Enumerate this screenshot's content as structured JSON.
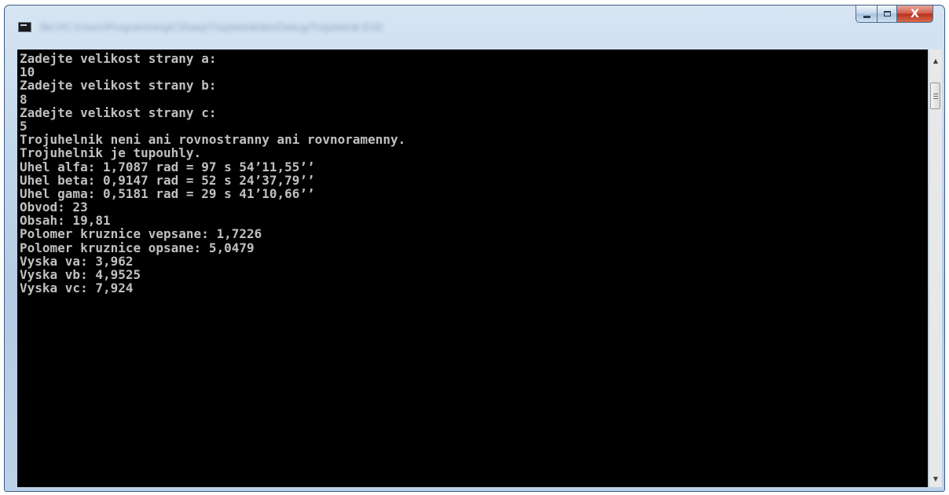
{
  "window": {
    "title": "file:///C:/Users/Programming/CSharp/Trojuhelnik/bin/Debug/Trojuhelnik.EXE"
  },
  "controls": {
    "minimize_icon": "minimize-icon",
    "maximize_icon": "maximize-icon",
    "close_label": "X"
  },
  "console": {
    "lines": [
      "Zadejte velikost strany a:",
      "10",
      "Zadejte velikost strany b:",
      "8",
      "Zadejte velikost strany c:",
      "5",
      "Trojuhelnik neni ani rovnostranny ani rovnoramenny.",
      "Trojuhelnik je tupouhly.",
      "Uhel alfa: 1,7087 rad = 97 s 54’11,55’’",
      "Uhel beta: 0,9147 rad = 52 s 24’37,79’’",
      "Uhel gama: 0,5181 rad = 29 s 41’10,66’’",
      "Obvod: 23",
      "Obsah: 19,81",
      "Polomer kruznice vepsane: 1,7226",
      "Polomer kruznice opsane: 5,0479",
      "Vyska va: 3,962",
      "Vyska vb: 4,9525",
      "Vyska vc: 7,924"
    ]
  },
  "scrollbar": {
    "up_arrow": "▲",
    "down_arrow": "▼"
  },
  "colors": {
    "console_background": "#000000",
    "console_text": "#c0c0c0",
    "close_button": "#c84a38"
  }
}
